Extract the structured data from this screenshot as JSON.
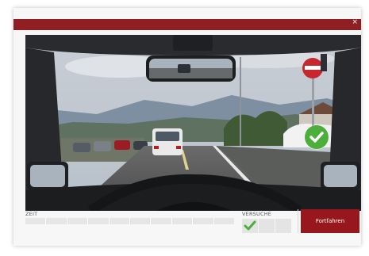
{
  "dialog": {
    "close_label": "×"
  },
  "footer": {
    "time_label": "ZEIT",
    "tries_label": "VERSUCHE",
    "continue_label": "Fortfahren",
    "time_progress": 0.0,
    "tries_passed": 1,
    "tries_total": 3
  },
  "icons": {
    "result": "check-circle-icon",
    "try_mark": "check-icon"
  },
  "colors": {
    "header_bar": "#8f1f23",
    "primary_button": "#98171c",
    "success": "#4cae3b"
  }
}
